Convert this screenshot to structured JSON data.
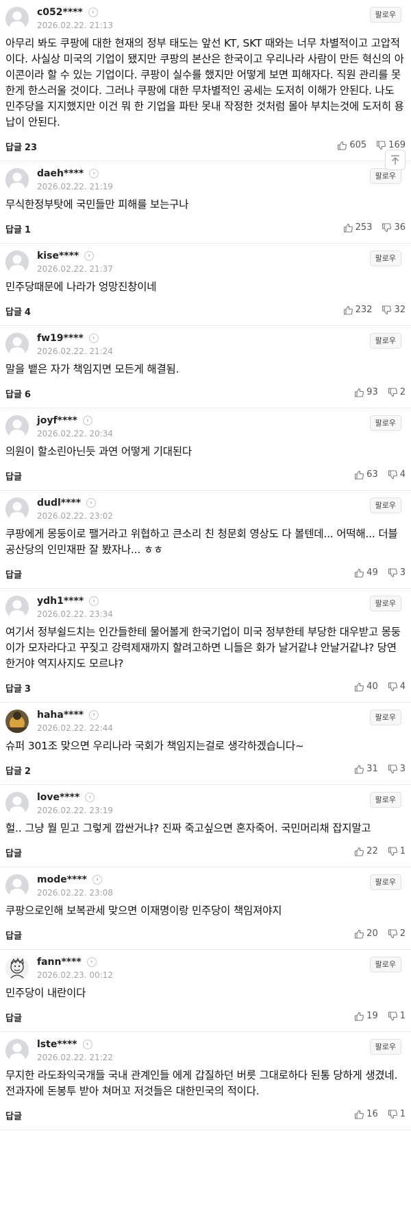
{
  "labels": {
    "follow": "팔로우",
    "reply": "답글"
  },
  "comments": [
    {
      "user": "c052****",
      "date": "2026.02.22. 21:13",
      "text": "아무리 봐도 쿠팡에 대한 현재의 정부 태도는 앞선 KT, SKT 때와는 너무 차별적이고 고압적이다. 사실상 미국의 기업이 됐지만 쿠팡의 본산은 한국이고 우리나라 사람이 만든 혁신의 아이콘이라 할 수 있는 기업이다. 쿠팡이 실수를 했지만 어떻게 보면 피해자다. 직원 관리를 못한게 한스러울 것이다. 그러나 쿠팡에 대한 무차별적인 공세는 도저히 이해가 안된다. 나도 민주당을 지지했지만 이건 뭐 한 기업을 파탄 못내 작정한 것처럼 몰아 부치는것에 도저히 용납이 안된다.",
      "replies": "23",
      "likes": "605",
      "dislikes": "169",
      "avatar": "default"
    },
    {
      "user": "daeh****",
      "date": "2026.02.22. 21:19",
      "text": "무식한정부탓에 국민들만 피해를 보는구나",
      "replies": "1",
      "likes": "253",
      "dislikes": "36",
      "avatar": "default"
    },
    {
      "user": "kise****",
      "date": "2026.02.22. 21:37",
      "text": "민주당때문에 나라가 엉망진창이네",
      "replies": "4",
      "likes": "232",
      "dislikes": "32",
      "avatar": "default"
    },
    {
      "user": "fw19****",
      "date": "2026.02.22. 21:24",
      "text": "말을 뱉은 자가 책임지면 모든게 해결됨.",
      "replies": "6",
      "likes": "93",
      "dislikes": "2",
      "avatar": "default"
    },
    {
      "user": "joyf****",
      "date": "2026.02.22. 20:34",
      "text": "의원이 할소린아닌듯 과연 어떻게 기대된다",
      "replies": "",
      "likes": "63",
      "dislikes": "4",
      "avatar": "default"
    },
    {
      "user": "dudl****",
      "date": "2026.02.22. 23:02",
      "text": "쿠팡에게 몽둥이로 팰거라고 위협하고 큰소리 친 청문회 영상도 다 볼텐데... 어떡해... 더블공산당의 인민재판 잘 봤자나... ㅎㅎ",
      "replies": "",
      "likes": "49",
      "dislikes": "3",
      "avatar": "default"
    },
    {
      "user": "ydh1****",
      "date": "2026.02.22. 23:34",
      "text": "여기서 정부쉴드치는 인간들한테 물어볼게 한국기업이 미국 정부한테 부당한 대우받고 몽둥이가 모자라다고 꾸짖고 강력제재까지 할려고하면 니들은 화가 날거같냐 안날거같냐? 당연한거야 역지사지도 모르냐?",
      "replies": "3",
      "likes": "40",
      "dislikes": "4",
      "avatar": "default"
    },
    {
      "user": "haha****",
      "date": "2026.02.22. 22:44",
      "text": "슈퍼 301조 맞으면 우리나라 국회가 책임지는걸로 생각하겠습니다~",
      "replies": "2",
      "likes": "31",
      "dislikes": "3",
      "avatar": "photo"
    },
    {
      "user": "love****",
      "date": "2026.02.22. 23:19",
      "text": "헐.. 그냥 뭘 믿고 그렇게 깝싼거냐? 진짜 죽고싶으면 혼자죽어. 국민머리채 잡지말고",
      "replies": "",
      "likes": "22",
      "dislikes": "1",
      "avatar": "default"
    },
    {
      "user": "mode****",
      "date": "2026.02.22. 23:08",
      "text": "쿠팡으로인해 보복관세 맞으면 이재명이랑 민주당이 책임져야지",
      "replies": "",
      "likes": "20",
      "dislikes": "2",
      "avatar": "default"
    },
    {
      "user": "fann****",
      "date": "2026.02.23. 00:12",
      "text": "민주당이 내란이다",
      "replies": "",
      "likes": "19",
      "dislikes": "1",
      "avatar": "sketch"
    },
    {
      "user": "lste****",
      "date": "2026.02.22. 21:22",
      "text": "무지한 라도좌익국개들 국내 관계인들 에게 갑질하던 버릇 그대로하다 된통 당하게 생겼네.전과자에 돈봉투 받아 쳐머꼬 저것들은 대한민국의 적이다.",
      "replies": "",
      "likes": "16",
      "dislikes": "1",
      "avatar": "default"
    }
  ],
  "scroll_top_icon": "arrow-up-icon"
}
